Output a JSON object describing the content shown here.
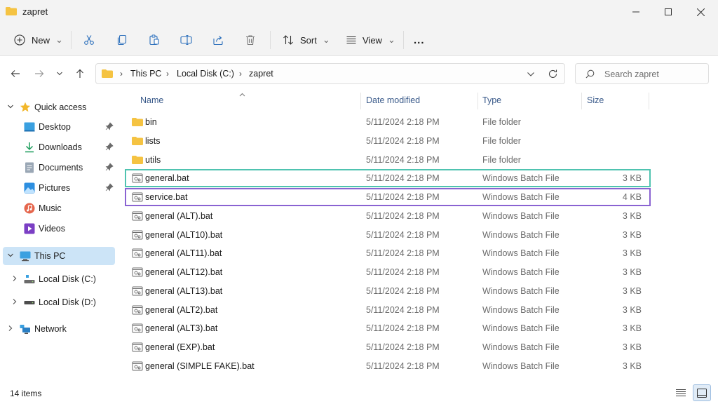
{
  "window": {
    "title": "zapret"
  },
  "toolbar": {
    "new_label": "New",
    "sort_label": "Sort",
    "view_label": "View",
    "more_label": "..."
  },
  "address": {
    "crumbs": [
      "This PC",
      "Local Disk (C:)",
      "zapret"
    ],
    "search_placeholder": "Search zapret"
  },
  "sidebar": {
    "quick_access": "Quick access",
    "items": [
      {
        "label": "Desktop",
        "icon": "desktop-icon",
        "pinned": true
      },
      {
        "label": "Downloads",
        "icon": "download-icon",
        "pinned": true
      },
      {
        "label": "Documents",
        "icon": "documents-icon",
        "pinned": true
      },
      {
        "label": "Pictures",
        "icon": "pictures-icon",
        "pinned": true
      },
      {
        "label": "Music",
        "icon": "music-icon",
        "pinned": false
      },
      {
        "label": "Videos",
        "icon": "videos-icon",
        "pinned": false
      }
    ],
    "this_pc": "This PC",
    "drives": [
      "Local Disk (C:)",
      "Local Disk (D:)"
    ],
    "network": "Network"
  },
  "columns": {
    "name": "Name",
    "date": "Date modified",
    "type": "Type",
    "size": "Size"
  },
  "files": [
    {
      "name": "bin",
      "date": "5/11/2024 2:18 PM",
      "type": "File folder",
      "size": "",
      "kind": "folder"
    },
    {
      "name": "lists",
      "date": "5/11/2024 2:18 PM",
      "type": "File folder",
      "size": "",
      "kind": "folder"
    },
    {
      "name": "utils",
      "date": "5/11/2024 2:18 PM",
      "type": "File folder",
      "size": "",
      "kind": "folder"
    },
    {
      "name": "general.bat",
      "date": "5/11/2024 2:18 PM",
      "type": "Windows Batch File",
      "size": "3 KB",
      "kind": "bat"
    },
    {
      "name": "service.bat",
      "date": "5/11/2024 2:18 PM",
      "type": "Windows Batch File",
      "size": "4 KB",
      "kind": "bat"
    },
    {
      "name": "general (ALT).bat",
      "date": "5/11/2024 2:18 PM",
      "type": "Windows Batch File",
      "size": "3 KB",
      "kind": "bat"
    },
    {
      "name": "general (ALT10).bat",
      "date": "5/11/2024 2:18 PM",
      "type": "Windows Batch File",
      "size": "3 KB",
      "kind": "bat"
    },
    {
      "name": "general (ALT11).bat",
      "date": "5/11/2024 2:18 PM",
      "type": "Windows Batch File",
      "size": "3 KB",
      "kind": "bat"
    },
    {
      "name": "general (ALT12).bat",
      "date": "5/11/2024 2:18 PM",
      "type": "Windows Batch File",
      "size": "3 KB",
      "kind": "bat"
    },
    {
      "name": "general (ALT13).bat",
      "date": "5/11/2024 2:18 PM",
      "type": "Windows Batch File",
      "size": "3 KB",
      "kind": "bat"
    },
    {
      "name": "general (ALT2).bat",
      "date": "5/11/2024 2:18 PM",
      "type": "Windows Batch File",
      "size": "3 KB",
      "kind": "bat"
    },
    {
      "name": "general (ALT3).bat",
      "date": "5/11/2024 2:18 PM",
      "type": "Windows Batch File",
      "size": "3 KB",
      "kind": "bat"
    },
    {
      "name": "general (EXP).bat",
      "date": "5/11/2024 2:18 PM",
      "type": "Windows Batch File",
      "size": "3 KB",
      "kind": "bat"
    },
    {
      "name": "general (SIMPLE FAKE).bat",
      "date": "5/11/2024 2:18 PM",
      "type": "Windows Batch File",
      "size": "3 KB",
      "kind": "bat"
    }
  ],
  "status": {
    "items_count": "14 items"
  },
  "colors": {
    "folder": "#f5c342",
    "selected": "#cce4f7",
    "teal_highlight": "#4fc3b0",
    "purple_highlight": "#8a63d2"
  }
}
